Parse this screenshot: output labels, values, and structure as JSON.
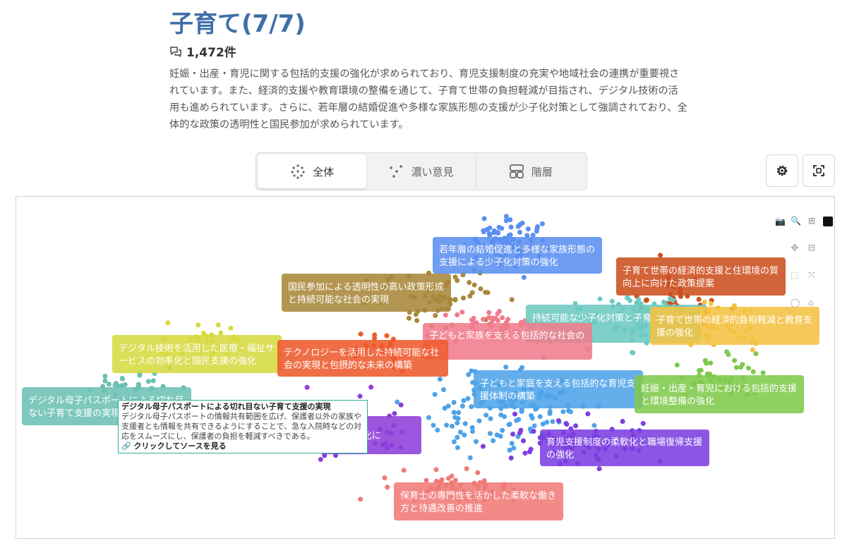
{
  "header": {
    "title": "子育て(7/7)",
    "count": "1,472件",
    "description": "妊娠・出産・育児に関する包括的支援の強化が求められており、育児支援制度の充実や地域社会の連携が重要視されています。また、経済的支援や教育環境の整備を通じて、子育て世帯の負担軽減が目指され、デジタル技術の活用も進められています。さらに、若年層の結婚促進や多様な家族形態の支援が少子化対策として強調されており、全体的な政策の透明性と国民参加が求められています。"
  },
  "tabs": [
    {
      "label": "全体",
      "icon": "scatter-dots-icon",
      "active": true
    },
    {
      "label": "濃い意見",
      "icon": "sparse-dots-icon",
      "active": false
    },
    {
      "label": "階層",
      "icon": "hierarchy-icon",
      "active": false
    }
  ],
  "toolbar": {
    "settings_icon": "gear-icon",
    "fullscreen_icon": "fullscreen-icon"
  },
  "modebar": [
    "camera-icon",
    "zoom-icon",
    "zoom-in-icon",
    "bar-logo-icon",
    "pan-icon",
    "zoom-out-icon",
    "box-select-icon",
    "autoscale-icon",
    "lasso-icon",
    "home-icon"
  ],
  "chart_data": {
    "type": "scatter",
    "title": "",
    "xlabel": "",
    "ylabel": "",
    "grid": false,
    "clusters": [
      {
        "label": "若年層の結婚促進と多様な家族形態の支援による少子化対策の強化",
        "color": "#5b8ff0"
      },
      {
        "label": "子育て世帯の経済的支援と住環境の質向上に向けた政策提案",
        "color": "#cc4f1f"
      },
      {
        "label": "国民参加による透明性の高い政策形成と持続可能な社会の実現",
        "color": "#a8883a"
      },
      {
        "label": "持続可能な少子化対策と子育て支援の強化",
        "color": "#6cc9c0"
      },
      {
        "label": "子育て世帯の経済的負担軽減と教育支援の強化",
        "color": "#f4c242"
      },
      {
        "label": "子どもと家族を支える包括的な社会の実現",
        "color": "#f07c8c"
      },
      {
        "label": "デジタル技術を活用した医療・福祉サービスの効率化と国民支援の強化",
        "color": "#d6d940"
      },
      {
        "label": "テクノロジーを活用した持続可能な社会の実現と包摂的な未来の構築",
        "color": "#ee5a2c"
      },
      {
        "label": "子どもと家庭を支える包括的な育児支援体制の構築",
        "color": "#4ea3e8"
      },
      {
        "label": "妊娠・出産・育児における包括的支援と環境整備の強化",
        "color": "#7fc94c"
      },
      {
        "label": "デジタル母子パスポートによる切れ目ない子育て支援の実現",
        "color": "#6cc0b4"
      },
      {
        "label": "デジタル化に",
        "color": "#8d3fd8"
      },
      {
        "label": "育児支援制度の柔軟化と職場復帰支援の強化",
        "color": "#7c3fe0"
      },
      {
        "label": "保育士の専門性を活かした柔軟な働き方と待遇改善の推進",
        "color": "#f07a78"
      }
    ]
  },
  "tooltip": {
    "title": "デジタル母子パスポートによる切れ目ない子育て支援の実現",
    "body": "デジタル母子パスポートの情報共有範囲を広げ、保護者以外の家族や支援者とも情報を共有できるようにすることで、急な入院時などの対応をスムーズにし、保護者の負担を軽減すべきである。",
    "link": "🔗 クリックしてソースを見る"
  }
}
